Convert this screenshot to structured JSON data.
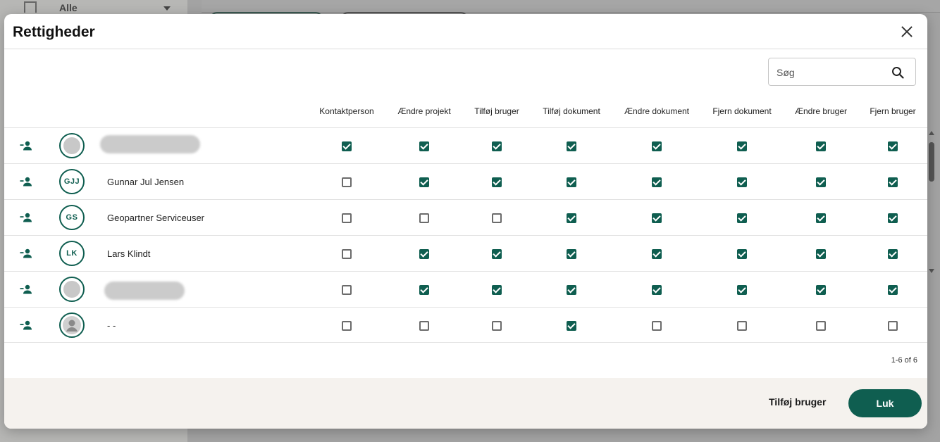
{
  "background": {
    "filter_label": "Alle"
  },
  "dialog": {
    "title": "Rettigheder",
    "search": {
      "placeholder": "Søg",
      "value": ""
    },
    "columns": [
      "Kontaktperson",
      "Ændre projekt",
      "Tilføj bruger",
      "Tilføj dokument",
      "Ændre dokument",
      "Fjern dokument",
      "Ændre bruger",
      "Fjern bruger"
    ],
    "rows": [
      {
        "initials": "",
        "name": "",
        "avatar_style": "blank",
        "redacted": true,
        "permissions": [
          true,
          true,
          true,
          true,
          true,
          true,
          true,
          true
        ]
      },
      {
        "initials": "GJJ",
        "name": "Gunnar Jul Jensen",
        "avatar_style": "initials",
        "redacted": false,
        "permissions": [
          false,
          true,
          true,
          true,
          true,
          true,
          true,
          true
        ]
      },
      {
        "initials": "GS",
        "name": "Geopartner Serviceuser",
        "avatar_style": "initials",
        "redacted": false,
        "permissions": [
          false,
          false,
          false,
          true,
          true,
          true,
          true,
          true
        ]
      },
      {
        "initials": "LK",
        "name": "Lars Klindt",
        "avatar_style": "initials",
        "redacted": false,
        "permissions": [
          false,
          true,
          true,
          true,
          true,
          true,
          true,
          true
        ]
      },
      {
        "initials": "",
        "name": "",
        "avatar_style": "blank",
        "redacted": true,
        "permissions": [
          false,
          true,
          true,
          true,
          true,
          true,
          true,
          true
        ]
      },
      {
        "initials": "",
        "name": "- -",
        "avatar_style": "person-icon",
        "redacted": false,
        "permissions": [
          false,
          false,
          false,
          true,
          false,
          false,
          false,
          false
        ]
      }
    ],
    "pagination": "1-6 of 6",
    "footer": {
      "add_user_label": "Tilføj bruger",
      "close_label": "Luk"
    }
  },
  "colors": {
    "accent": "#0f5e50",
    "footer_bg": "#f5f2ee"
  }
}
